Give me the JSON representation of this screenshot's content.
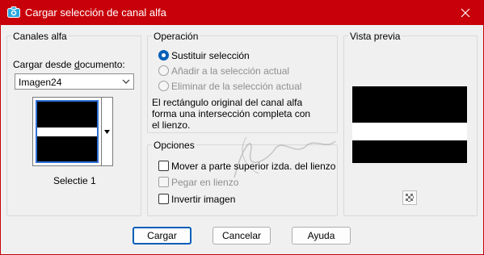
{
  "window": {
    "title": "Cargar selección de canal alfa",
    "accent_color": "#c8000a",
    "app_icon": "camera-icon",
    "close_icon": "close-icon"
  },
  "canales": {
    "legend": "Canales alfa",
    "source_label": "Cargar desde documento:",
    "document_value": "Imagen24",
    "channel_name": "Selectie 1"
  },
  "operacion": {
    "legend": "Operación",
    "options": [
      {
        "label": "Sustituir selección",
        "checked": true,
        "disabled": false
      },
      {
        "label": "Añadir a la selección actual",
        "checked": false,
        "disabled": true
      },
      {
        "label": "Eliminar de la selección actual",
        "checked": false,
        "disabled": true
      }
    ],
    "description_lines": [
      "El rectángulo original del canal alfa",
      "forma una intersección completa con",
      "el lienzo."
    ]
  },
  "opciones": {
    "legend": "Opciones",
    "checks": [
      {
        "label": "Mover a parte superior izda. del lienzo",
        "checked": false,
        "disabled": false
      },
      {
        "label": "Pegar en lienzo",
        "checked": false,
        "disabled": true
      },
      {
        "label": "Invertir imagen",
        "checked": false,
        "disabled": false
      }
    ]
  },
  "preview": {
    "legend": "Vista previa",
    "zoom_icon": "checkerboard-icon"
  },
  "buttons": {
    "ok": "Cargar",
    "cancel": "Cancelar",
    "help": "Ayuda"
  }
}
